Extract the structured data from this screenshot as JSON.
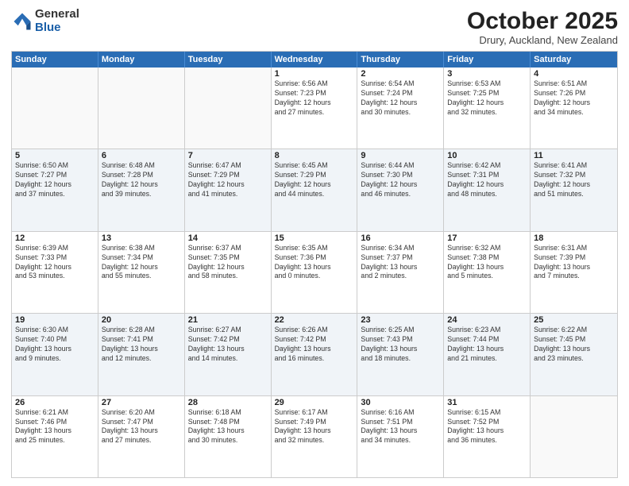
{
  "logo": {
    "general": "General",
    "blue": "Blue"
  },
  "header": {
    "month": "October 2025",
    "location": "Drury, Auckland, New Zealand"
  },
  "weekdays": [
    "Sunday",
    "Monday",
    "Tuesday",
    "Wednesday",
    "Thursday",
    "Friday",
    "Saturday"
  ],
  "rows": [
    [
      {
        "day": "",
        "info": ""
      },
      {
        "day": "",
        "info": ""
      },
      {
        "day": "",
        "info": ""
      },
      {
        "day": "1",
        "info": "Sunrise: 6:56 AM\nSunset: 7:23 PM\nDaylight: 12 hours\nand 27 minutes."
      },
      {
        "day": "2",
        "info": "Sunrise: 6:54 AM\nSunset: 7:24 PM\nDaylight: 12 hours\nand 30 minutes."
      },
      {
        "day": "3",
        "info": "Sunrise: 6:53 AM\nSunset: 7:25 PM\nDaylight: 12 hours\nand 32 minutes."
      },
      {
        "day": "4",
        "info": "Sunrise: 6:51 AM\nSunset: 7:26 PM\nDaylight: 12 hours\nand 34 minutes."
      }
    ],
    [
      {
        "day": "5",
        "info": "Sunrise: 6:50 AM\nSunset: 7:27 PM\nDaylight: 12 hours\nand 37 minutes."
      },
      {
        "day": "6",
        "info": "Sunrise: 6:48 AM\nSunset: 7:28 PM\nDaylight: 12 hours\nand 39 minutes."
      },
      {
        "day": "7",
        "info": "Sunrise: 6:47 AM\nSunset: 7:29 PM\nDaylight: 12 hours\nand 41 minutes."
      },
      {
        "day": "8",
        "info": "Sunrise: 6:45 AM\nSunset: 7:29 PM\nDaylight: 12 hours\nand 44 minutes."
      },
      {
        "day": "9",
        "info": "Sunrise: 6:44 AM\nSunset: 7:30 PM\nDaylight: 12 hours\nand 46 minutes."
      },
      {
        "day": "10",
        "info": "Sunrise: 6:42 AM\nSunset: 7:31 PM\nDaylight: 12 hours\nand 48 minutes."
      },
      {
        "day": "11",
        "info": "Sunrise: 6:41 AM\nSunset: 7:32 PM\nDaylight: 12 hours\nand 51 minutes."
      }
    ],
    [
      {
        "day": "12",
        "info": "Sunrise: 6:39 AM\nSunset: 7:33 PM\nDaylight: 12 hours\nand 53 minutes."
      },
      {
        "day": "13",
        "info": "Sunrise: 6:38 AM\nSunset: 7:34 PM\nDaylight: 12 hours\nand 55 minutes."
      },
      {
        "day": "14",
        "info": "Sunrise: 6:37 AM\nSunset: 7:35 PM\nDaylight: 12 hours\nand 58 minutes."
      },
      {
        "day": "15",
        "info": "Sunrise: 6:35 AM\nSunset: 7:36 PM\nDaylight: 13 hours\nand 0 minutes."
      },
      {
        "day": "16",
        "info": "Sunrise: 6:34 AM\nSunset: 7:37 PM\nDaylight: 13 hours\nand 2 minutes."
      },
      {
        "day": "17",
        "info": "Sunrise: 6:32 AM\nSunset: 7:38 PM\nDaylight: 13 hours\nand 5 minutes."
      },
      {
        "day": "18",
        "info": "Sunrise: 6:31 AM\nSunset: 7:39 PM\nDaylight: 13 hours\nand 7 minutes."
      }
    ],
    [
      {
        "day": "19",
        "info": "Sunrise: 6:30 AM\nSunset: 7:40 PM\nDaylight: 13 hours\nand 9 minutes."
      },
      {
        "day": "20",
        "info": "Sunrise: 6:28 AM\nSunset: 7:41 PM\nDaylight: 13 hours\nand 12 minutes."
      },
      {
        "day": "21",
        "info": "Sunrise: 6:27 AM\nSunset: 7:42 PM\nDaylight: 13 hours\nand 14 minutes."
      },
      {
        "day": "22",
        "info": "Sunrise: 6:26 AM\nSunset: 7:42 PM\nDaylight: 13 hours\nand 16 minutes."
      },
      {
        "day": "23",
        "info": "Sunrise: 6:25 AM\nSunset: 7:43 PM\nDaylight: 13 hours\nand 18 minutes."
      },
      {
        "day": "24",
        "info": "Sunrise: 6:23 AM\nSunset: 7:44 PM\nDaylight: 13 hours\nand 21 minutes."
      },
      {
        "day": "25",
        "info": "Sunrise: 6:22 AM\nSunset: 7:45 PM\nDaylight: 13 hours\nand 23 minutes."
      }
    ],
    [
      {
        "day": "26",
        "info": "Sunrise: 6:21 AM\nSunset: 7:46 PM\nDaylight: 13 hours\nand 25 minutes."
      },
      {
        "day": "27",
        "info": "Sunrise: 6:20 AM\nSunset: 7:47 PM\nDaylight: 13 hours\nand 27 minutes."
      },
      {
        "day": "28",
        "info": "Sunrise: 6:18 AM\nSunset: 7:48 PM\nDaylight: 13 hours\nand 30 minutes."
      },
      {
        "day": "29",
        "info": "Sunrise: 6:17 AM\nSunset: 7:49 PM\nDaylight: 13 hours\nand 32 minutes."
      },
      {
        "day": "30",
        "info": "Sunrise: 6:16 AM\nSunset: 7:51 PM\nDaylight: 13 hours\nand 34 minutes."
      },
      {
        "day": "31",
        "info": "Sunrise: 6:15 AM\nSunset: 7:52 PM\nDaylight: 13 hours\nand 36 minutes."
      },
      {
        "day": "",
        "info": ""
      }
    ]
  ]
}
